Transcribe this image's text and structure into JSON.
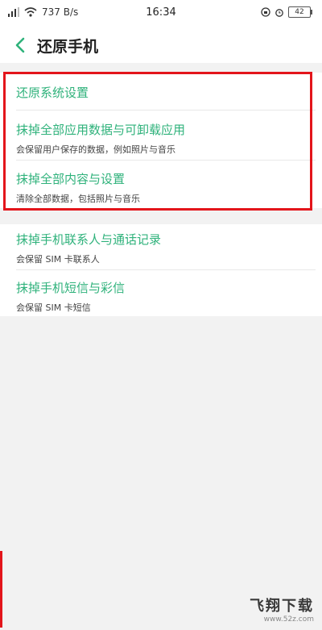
{
  "status_bar": {
    "speed": "737 B/s",
    "time": "16:34",
    "battery": "42"
  },
  "header": {
    "title": "还原手机"
  },
  "items": [
    {
      "title": "还原系统设置",
      "subtitle": ""
    },
    {
      "title": "抹掉全部应用数据与可卸载应用",
      "subtitle": "会保留用户保存的数据，例如照片与音乐"
    },
    {
      "title": "抹掉全部内容与设置",
      "subtitle": "清除全部数据，包括照片与音乐"
    },
    {
      "title": "抹掉手机联系人与通话记录",
      "subtitle": "会保留 SIM 卡联系人"
    },
    {
      "title": "抹掉手机短信与彩信",
      "subtitle": "会保留 SIM 卡短信"
    }
  ],
  "watermark": {
    "name": "飞翔下载",
    "url": "www.52z.com"
  },
  "colors": {
    "accent": "#2fb27b",
    "highlight": "#e3151b",
    "background": "#f2f2f2"
  },
  "icons": [
    "signal-icon",
    "wifi-icon",
    "rotation-lock-icon",
    "alarm-icon",
    "battery-icon",
    "back-arrow-icon"
  ]
}
